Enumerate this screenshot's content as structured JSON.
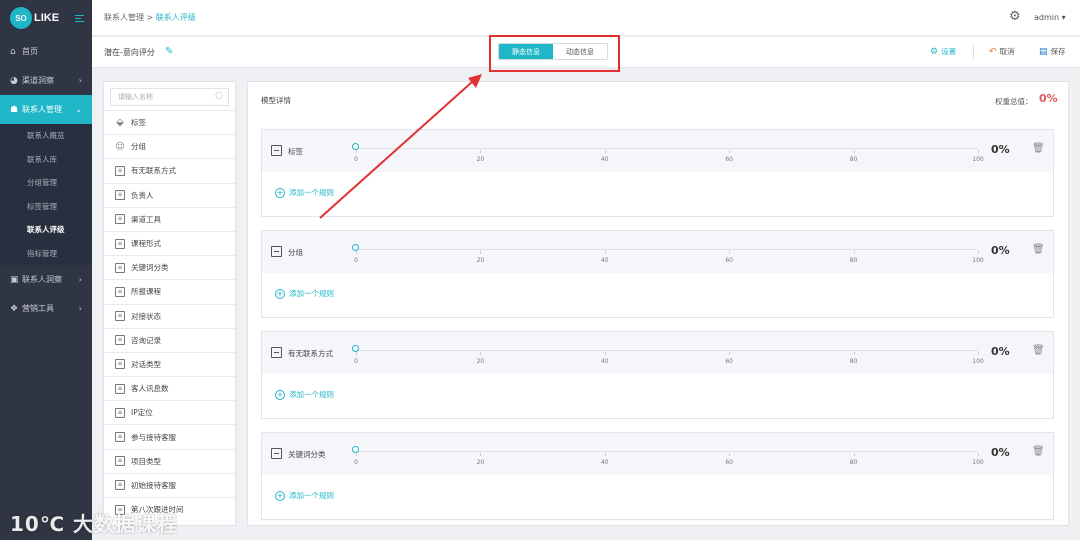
{
  "app": {
    "logo_text": "SO",
    "logo_text2": "LIKE"
  },
  "breadcrumb": {
    "parent": "联系人管理",
    "separator": " > ",
    "current": "联系人评级"
  },
  "header": {
    "user": "admin ▾"
  },
  "sidebar": {
    "items": [
      {
        "icon": "home-icon",
        "label": "首页"
      },
      {
        "icon": "pie-chart-icon",
        "label": "渠道洞察"
      },
      {
        "icon": "contacts-icon",
        "label": "联系人管理"
      },
      {
        "icon": "id-card-icon",
        "label": "联系人洞察"
      },
      {
        "icon": "cubes-icon",
        "label": "营销工具"
      }
    ],
    "subitems": [
      "联系人概览",
      "联系人库",
      "分组管理",
      "标签管理",
      "联系人评级",
      "指标管理"
    ]
  },
  "toolbar": {
    "status_label": "潜在-意向评分",
    "tab_static": "静态信息",
    "tab_dynamic": "动态信息",
    "settings": "设置",
    "cancel": "取消",
    "save": "保存"
  },
  "left_panel": {
    "search_placeholder": "请输入名称",
    "items": [
      "标签",
      "分组",
      "有无联系方式",
      "负责人",
      "渠道工具",
      "课程形式",
      "关键词分类",
      "所报课程",
      "对接状态",
      "咨询记录",
      "对话类型",
      "客人讯息数",
      "IP定位",
      "参与接待客服",
      "项目类型",
      "初始接待客服",
      "第八次跟进时间"
    ]
  },
  "main": {
    "title": "模型详情",
    "weight_label": "权重总值：",
    "weight_value": "0%",
    "add_rule": "添加一个规则",
    "slider_ticks": [
      "0",
      "20",
      "40",
      "60",
      "80",
      "100"
    ],
    "blocks": [
      {
        "name": "标签",
        "percent": "0%",
        "value": 0
      },
      {
        "name": "分组",
        "percent": "0%",
        "value": 0
      },
      {
        "name": "有无联系方式",
        "percent": "0%",
        "value": 0
      },
      {
        "name": "关键词分类",
        "percent": "0%",
        "value": 0
      }
    ]
  },
  "watermark": "10℃ 大数据课程",
  "colors": {
    "accent": "#1fb6c8",
    "sidebar": "#2f3542",
    "highlight": "#e03232",
    "weight": "#e05858"
  }
}
